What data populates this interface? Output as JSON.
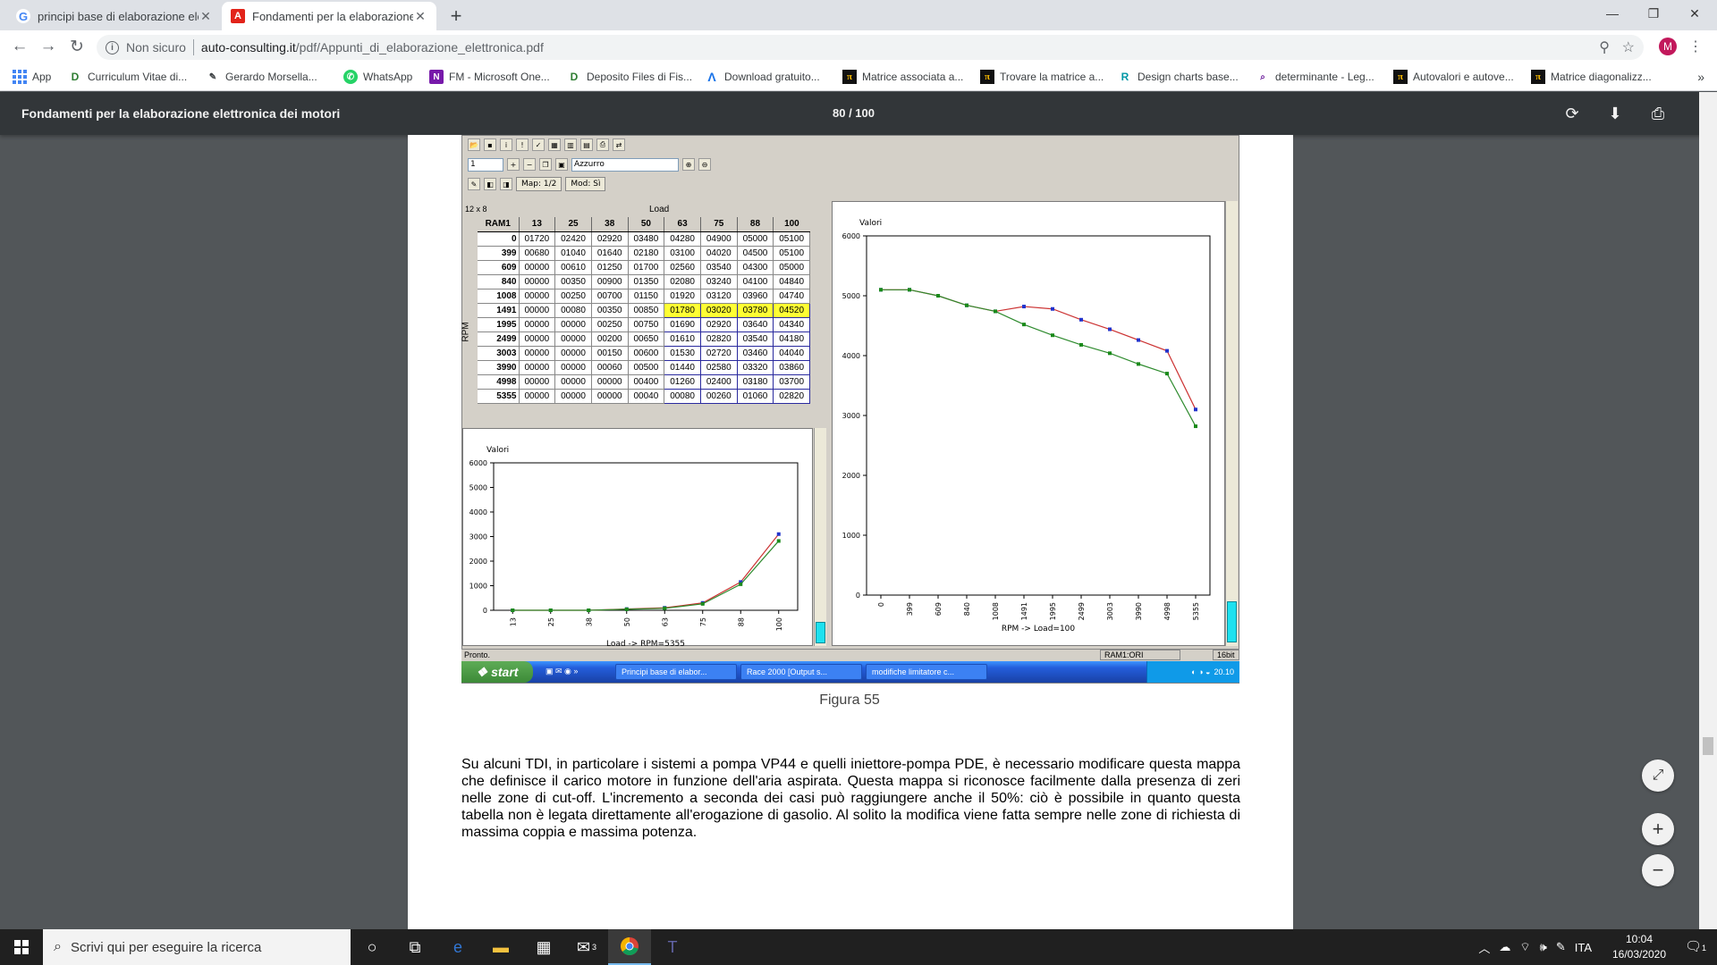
{
  "browser": {
    "tabs": [
      {
        "label": "principi base di elaborazione elet",
        "icon": "google-icon",
        "active": false
      },
      {
        "label": "Fondamenti per la elaborazione e",
        "icon": "pdf-icon",
        "active": true
      }
    ],
    "url": {
      "security": "Non sicuro",
      "host": "auto-consulting.it",
      "path": "/pdf/Appunti_di_elaborazione_elettronica.pdf"
    },
    "avatar_letter": "M",
    "bookmarks": [
      {
        "label": "App",
        "icon": "apps-icon"
      },
      {
        "label": "Curriculum Vitae di...",
        "icon": "drive-icon"
      },
      {
        "label": "Gerardo Morsella...",
        "icon": "user-icon"
      },
      {
        "label": "WhatsApp",
        "icon": "whatsapp-icon"
      },
      {
        "label": "FM - Microsoft One...",
        "icon": "onenote-icon"
      },
      {
        "label": "Deposito Files di Fis...",
        "icon": "drive-icon"
      },
      {
        "label": "Download gratuito...",
        "icon": "download-icon"
      },
      {
        "label": "Matrice associata a...",
        "icon": "tc-icon"
      },
      {
        "label": "Trovare la matrice a...",
        "icon": "tc-icon"
      },
      {
        "label": "Design charts base...",
        "icon": "chart-icon"
      },
      {
        "label": "determinante - Leg...",
        "icon": "doc-icon"
      },
      {
        "label": "Autovalori e autove...",
        "icon": "tc-icon"
      },
      {
        "label": "Matrice diagonalizz...",
        "icon": "tc-icon"
      }
    ]
  },
  "viewer": {
    "title": "Fondamenti per la elaborazione elettronica dei motori",
    "page_count": "80 / 100"
  },
  "app": {
    "toolbar": {
      "field1": "1",
      "combo": "Azzurro",
      "map_label": "Map: 1/2",
      "mod_label": "Mod: Sì"
    },
    "grid_size": "12 x 8",
    "load_label": "Load",
    "rpm_label": "RPM",
    "corner_label": "RAM1",
    "status_text": "Pronto.",
    "status_map": "RAM1:ORI",
    "status_bits": "16bit"
  },
  "table": {
    "columns": [
      "13",
      "25",
      "38",
      "50",
      "63",
      "75",
      "88",
      "100"
    ],
    "rows": [
      {
        "rpm": "0",
        "values": [
          "01720",
          "02420",
          "02920",
          "03480",
          "04280",
          "04900",
          "05000",
          "05100"
        ]
      },
      {
        "rpm": "399",
        "values": [
          "00680",
          "01040",
          "01640",
          "02180",
          "03100",
          "04020",
          "04500",
          "05100"
        ]
      },
      {
        "rpm": "609",
        "values": [
          "00000",
          "00610",
          "01250",
          "01700",
          "02560",
          "03540",
          "04300",
          "05000"
        ]
      },
      {
        "rpm": "840",
        "values": [
          "00000",
          "00350",
          "00900",
          "01350",
          "02080",
          "03240",
          "04100",
          "04840"
        ]
      },
      {
        "rpm": "1008",
        "values": [
          "00000",
          "00250",
          "00700",
          "01150",
          "01920",
          "03120",
          "03960",
          "04740"
        ]
      },
      {
        "rpm": "1491",
        "values": [
          "00000",
          "00080",
          "00350",
          "00850",
          "01780",
          "03020",
          "03780",
          "04520"
        ]
      },
      {
        "rpm": "1995",
        "values": [
          "00000",
          "00000",
          "00250",
          "00750",
          "01690",
          "02920",
          "03640",
          "04340"
        ]
      },
      {
        "rpm": "2499",
        "values": [
          "00000",
          "00000",
          "00200",
          "00650",
          "01610",
          "02820",
          "03540",
          "04180"
        ]
      },
      {
        "rpm": "3003",
        "values": [
          "00000",
          "00000",
          "00150",
          "00600",
          "01530",
          "02720",
          "03460",
          "04040"
        ]
      },
      {
        "rpm": "3990",
        "values": [
          "00000",
          "00000",
          "00060",
          "00500",
          "01440",
          "02580",
          "03320",
          "03860"
        ]
      },
      {
        "rpm": "4998",
        "values": [
          "00000",
          "00000",
          "00000",
          "00400",
          "01260",
          "02400",
          "03180",
          "03700"
        ]
      },
      {
        "rpm": "5355",
        "values": [
          "00000",
          "00000",
          "00000",
          "00040",
          "00080",
          "00260",
          "01060",
          "02820"
        ]
      }
    ]
  },
  "chart_data": [
    {
      "type": "line",
      "title": "Valori",
      "xlabel": "Load -> RPM=5355",
      "categories": [
        "13",
        "25",
        "38",
        "50",
        "63",
        "75",
        "88",
        "100"
      ],
      "ylim": [
        0,
        6000
      ],
      "yticks": [
        0,
        1000,
        2000,
        3000,
        4000,
        5000,
        6000
      ],
      "series": [
        {
          "values": [
            0,
            0,
            0,
            40,
            80,
            260,
            1060,
            2820
          ],
          "color": "#2e8b2e"
        },
        {
          "values": [
            0,
            0,
            0,
            50,
            100,
            300,
            1150,
            3100
          ],
          "color": "#cc3333"
        }
      ]
    },
    {
      "type": "line",
      "title": "Valori",
      "xlabel": "RPM -> Load=100",
      "categories": [
        "0",
        "399",
        "609",
        "840",
        "1008",
        "1491",
        "1995",
        "2499",
        "3003",
        "3990",
        "4998",
        "5355"
      ],
      "ylim": [
        0,
        6000
      ],
      "yticks": [
        0,
        1000,
        2000,
        3000,
        4000,
        5000,
        6000
      ],
      "series": [
        {
          "values": [
            5100,
            5100,
            5000,
            4840,
            4740,
            4520,
            4340,
            4180,
            4040,
            3860,
            3700,
            2820
          ],
          "color": "#2e8b2e"
        },
        {
          "values": [
            5100,
            5100,
            5000,
            4840,
            4740,
            4820,
            4780,
            4600,
            4440,
            4260,
            4080,
            3100
          ],
          "color": "#cc3333"
        }
      ]
    }
  ],
  "xp_taskbar": {
    "start": "start",
    "tasks": [
      "Principi base di elabor...",
      "Race 2000 [Output s...",
      "modifiche limitatore c..."
    ],
    "time": "20.10"
  },
  "document": {
    "caption": "Figura 55",
    "paragraph": "Su alcuni TDI, in particolare i sistemi a pompa VP44 e quelli iniettore-pompa PDE, è necessario modificare questa mappa che definisce il carico motore in funzione dell'aria aspirata. Questa mappa si riconosce facilmente dalla presenza di zeri nelle zone di cut-off. L'incremento a seconda dei casi può raggiungere anche il 50%: ciò è possibile in quanto questa tabella non è legata direttamente all'erogazione di gasolio. Al solito la modifica viene fatta sempre nelle zone di richiesta di massima coppia e massima potenza."
  },
  "windows": {
    "search_placeholder": "Scrivi qui per eseguire la ricerca",
    "lang": "ITA",
    "time": "10:04",
    "date": "16/03/2020",
    "mail_badge": "3",
    "notif_count": "1"
  }
}
